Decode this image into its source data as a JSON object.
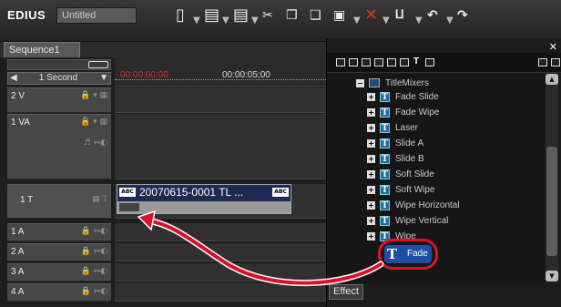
{
  "app": {
    "logo": "EDIUS",
    "project_name": "Untitled"
  },
  "toolbar": {
    "buttons": [
      {
        "icon": "new-project-icon",
        "glyph": "▯"
      },
      {
        "icon": "open-project-icon",
        "glyph": "▭"
      },
      {
        "icon": "save-icon",
        "glyph": "▤"
      },
      {
        "icon": "cut-icon",
        "glyph": "✂"
      },
      {
        "icon": "copy-icon",
        "glyph": "❐"
      },
      {
        "icon": "paste-icon",
        "glyph": "❑"
      },
      {
        "icon": "replace-icon",
        "glyph": "▫"
      },
      {
        "icon": "delete-icon",
        "glyph": "✕"
      },
      {
        "icon": "ripple-delete-icon",
        "glyph": "⨯"
      },
      {
        "icon": "undo-icon",
        "glyph": "↶"
      },
      {
        "icon": "redo-icon",
        "glyph": "↷"
      }
    ]
  },
  "sequence_tab": "Sequence1",
  "timeline": {
    "scale": "1 Second",
    "timecodes": [
      "00:00:00;00",
      "00:00:05;00"
    ],
    "tracks": [
      {
        "name": "2 V",
        "type": "video"
      },
      {
        "name": "1 VA",
        "type": "video-audio"
      },
      {
        "name": "1 T",
        "type": "title"
      },
      {
        "name": "1 A",
        "type": "audio"
      },
      {
        "name": "2 A",
        "type": "audio"
      },
      {
        "name": "3 A",
        "type": "audio"
      },
      {
        "name": "4 A",
        "type": "audio"
      }
    ],
    "clip": {
      "badge": "ABC",
      "label": "20070615-0001  TL ..."
    }
  },
  "effect_panel": {
    "tab": "Effect",
    "tree": {
      "folder": "TitleMixers",
      "items": [
        "Fade Slide",
        "Fade Wipe",
        "Laser",
        "Slide A",
        "Slide B",
        "Soft Slide",
        "Soft Wipe",
        "Wipe Horizontal",
        "Wipe Vertical",
        "Wipe"
      ],
      "highlighted": "Fade"
    },
    "highlight_color": "#e0102a"
  }
}
